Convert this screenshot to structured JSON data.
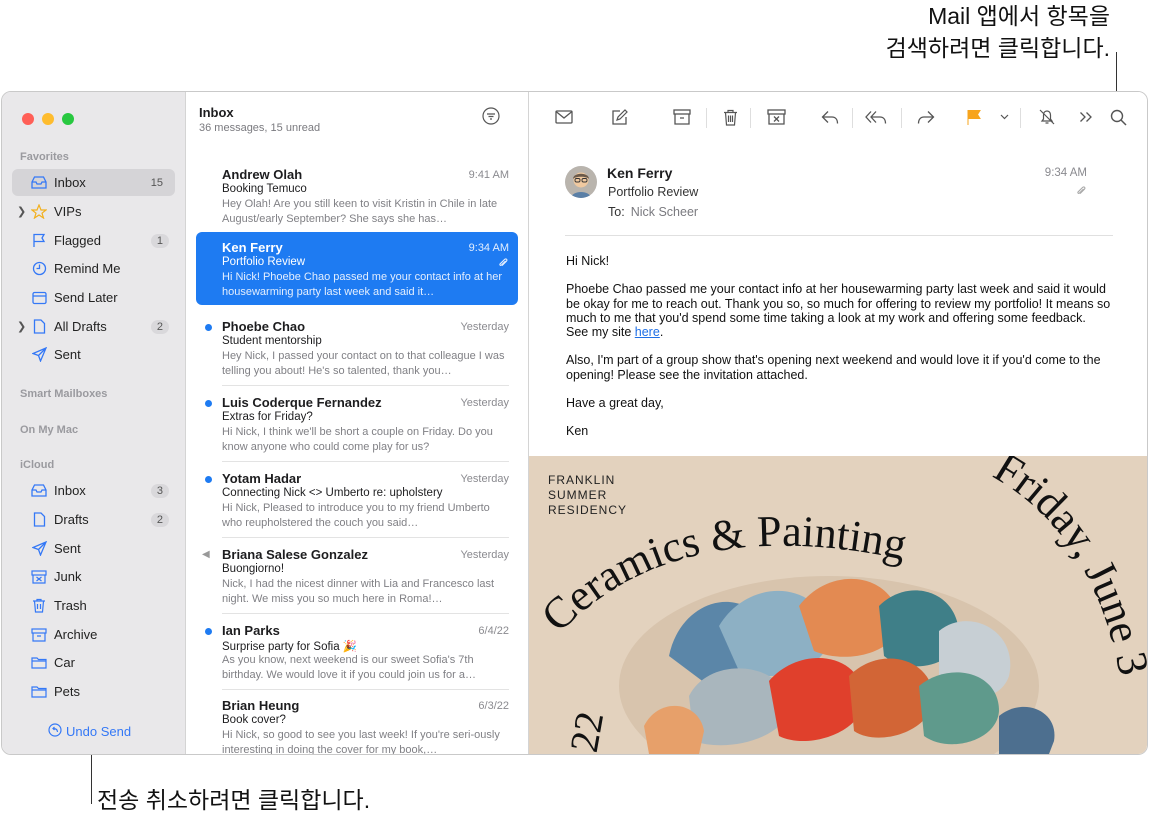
{
  "callouts": {
    "search_line1": "Mail 앱에서 항목을",
    "search_line2": "검색하려면 클릭합니다.",
    "undo": "전송 취소하려면 클릭합니다."
  },
  "colors": {
    "accent": "#1e7bf2",
    "flag": "#f7a41d",
    "close": "#ff5f57",
    "minimize": "#febc2e",
    "zoom": "#28c840"
  },
  "sidebar": {
    "favorites_header": "Favorites",
    "favorites": [
      {
        "label": "Inbox",
        "count": "15",
        "icon": "tray-icon"
      },
      {
        "label": "VIPs",
        "count": "",
        "icon": "star-icon"
      },
      {
        "label": "Flagged",
        "count": "1",
        "icon": "flag-icon"
      },
      {
        "label": "Remind Me",
        "count": "",
        "icon": "clock-icon"
      },
      {
        "label": "Send Later",
        "count": "",
        "icon": "calendar-icon"
      },
      {
        "label": "All Drafts",
        "count": "2",
        "icon": "document-icon"
      },
      {
        "label": "Sent",
        "count": "",
        "icon": "paperplane-icon"
      }
    ],
    "smart_header": "Smart Mailboxes",
    "onmymac_header": "On My Mac",
    "icloud_header": "iCloud",
    "icloud": [
      {
        "label": "Inbox",
        "count": "3",
        "icon": "tray-icon"
      },
      {
        "label": "Drafts",
        "count": "2",
        "icon": "document-icon"
      },
      {
        "label": "Sent",
        "count": "",
        "icon": "paperplane-icon"
      },
      {
        "label": "Junk",
        "count": "",
        "icon": "junk-icon"
      },
      {
        "label": "Trash",
        "count": "",
        "icon": "trash-icon"
      },
      {
        "label": "Archive",
        "count": "",
        "icon": "archive-icon"
      },
      {
        "label": "Car",
        "count": "",
        "icon": "folder-icon"
      },
      {
        "label": "Pets",
        "count": "",
        "icon": "folder-icon"
      }
    ],
    "undo_label": "Undo Send"
  },
  "list": {
    "title": "Inbox",
    "subtitle": "36 messages, 15 unread",
    "messages": [
      {
        "from": "Andrew Olah",
        "time": "9:41 AM",
        "subject": "Booking Temuco",
        "preview": "Hey Olah! Are you still keen to visit Kristin in Chile in late August/early September? She says she has…"
      },
      {
        "from": "Ken Ferry",
        "time": "9:34 AM",
        "subject": "Portfolio Review",
        "preview": "Hi Nick! Phoebe Chao passed me your contact info at her housewarming party last week and said it…"
      },
      {
        "from": "Phoebe Chao",
        "time": "Yesterday",
        "subject": "Student mentorship",
        "preview": "Hey Nick, I passed your contact on to that colleague I was telling you about! He's so talented, thank you…"
      },
      {
        "from": "Luis Coderque Fernandez",
        "time": "Yesterday",
        "subject": "Extras for Friday?",
        "preview": "Hi Nick, I think we'll be short a couple on Friday. Do you know anyone who could come play for us?"
      },
      {
        "from": "Yotam Hadar",
        "time": "Yesterday",
        "subject": "Connecting Nick <> Umberto re: upholstery",
        "preview": "Hi Nick, Pleased to introduce you to my friend Umberto who reupholstered the couch you said…"
      },
      {
        "from": "Briana Salese Gonzalez",
        "time": "Yesterday",
        "subject": "Buongiorno!",
        "preview": "Nick, I had the nicest dinner with Lia and Francesco last night. We miss you so much here in Roma!…"
      },
      {
        "from": "Ian Parks",
        "time": "6/4/22",
        "subject": "Surprise party for Sofia 🎉",
        "preview": "As you know, next weekend is our sweet Sofia's 7th birthday. We would love it if you could join us for a…"
      },
      {
        "from": "Brian Heung",
        "time": "6/3/22",
        "subject": "Book cover?",
        "preview": "Hi Nick, so good to see you last week! If you're seri-ously interesting in doing the cover for my book,…"
      }
    ]
  },
  "message": {
    "from": "Ken Ferry",
    "subject": "Portfolio Review",
    "to_label": "To:",
    "to_name": "Nick Scheer",
    "time": "9:34 AM",
    "greeting": "Hi Nick!",
    "para1": "Phoebe Chao passed me your contact info at her housewarming party last week and said it would be okay for me to reach out. Thank you so, so much for offering to review my portfolio! It means so much to me that you'd spend some time taking a look at my work and offering some feedback. See my site ",
    "link": "here",
    "para1_end": ".",
    "para2": "Also, I'm part of a group show that's opening next weekend and would love it if you'd come to the opening! Please see the invitation attached.",
    "closing": "Have a great day,",
    "signature": "Ken"
  },
  "poster": {
    "org_line1": "FRANKLIN",
    "org_line2": "SUMMER",
    "org_line3": "RESIDENCY",
    "title": "Ceramics & Painting",
    "date": "Friday, June 3",
    "year": "22"
  }
}
